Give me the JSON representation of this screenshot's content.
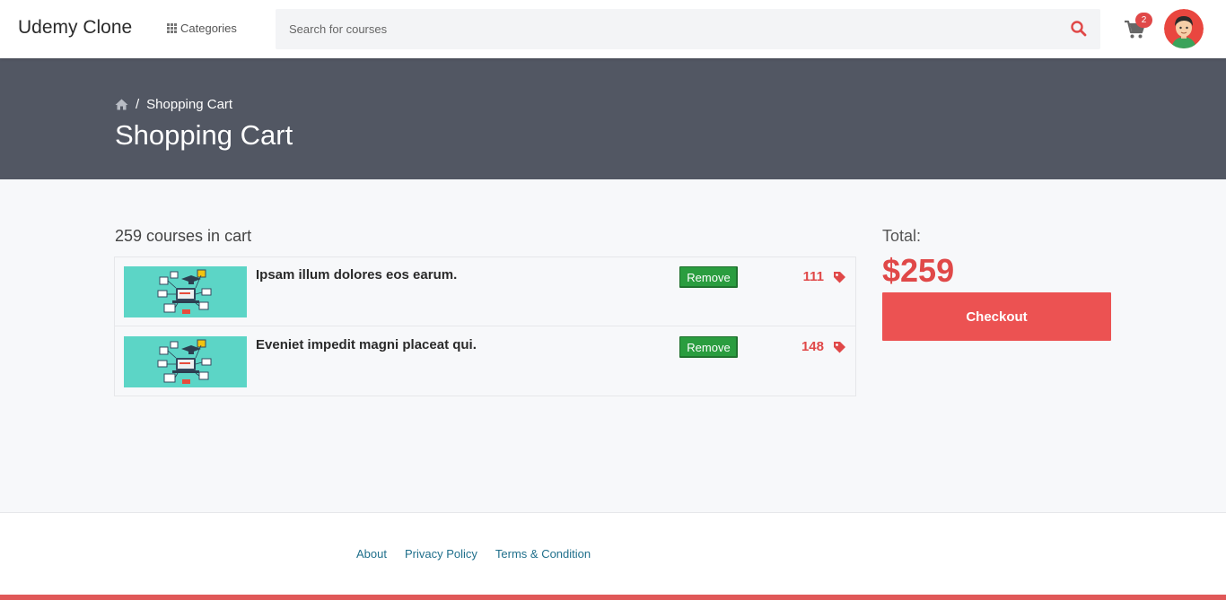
{
  "header": {
    "brand": "Udemy Clone",
    "categories_label": "Categories",
    "search_placeholder": "Search for courses",
    "cart_count": "2"
  },
  "hero": {
    "breadcrumb_current": "Shopping Cart",
    "title": "Shopping Cart"
  },
  "cart": {
    "count_text": "259 courses in cart",
    "remove_label": "Remove",
    "items": [
      {
        "title": "Ipsam illum dolores eos earum.",
        "price": "111"
      },
      {
        "title": "Eveniet impedit magni placeat qui.",
        "price": "148"
      }
    ]
  },
  "summary": {
    "total_label": "Total:",
    "total_value": "$259",
    "checkout_label": "Checkout"
  },
  "footer": {
    "links": [
      "About",
      "Privacy Policy",
      "Terms & Condition"
    ]
  },
  "colors": {
    "accent": "#ec5252",
    "hero_bg": "#525763",
    "remove_green": "#2a9d3f",
    "thumb_teal": "#5cd5c6"
  }
}
